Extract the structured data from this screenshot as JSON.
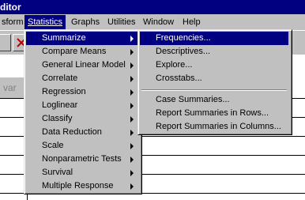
{
  "title": "ditor",
  "menubar": {
    "items": [
      {
        "label": "sform"
      },
      {
        "label": "Statistics"
      },
      {
        "label": "Graphs"
      },
      {
        "label": "Utilities"
      },
      {
        "label": "Window"
      },
      {
        "label": "Help"
      }
    ]
  },
  "grid": {
    "var_label": "var"
  },
  "statistics_menu": {
    "items": [
      {
        "label": "Summarize"
      },
      {
        "label": "Compare Means"
      },
      {
        "label": "General Linear Model"
      },
      {
        "label": "Correlate"
      },
      {
        "label": "Regression"
      },
      {
        "label": "Loglinear"
      },
      {
        "label": "Classify"
      },
      {
        "label": "Data Reduction"
      },
      {
        "label": "Scale"
      },
      {
        "label": "Nonparametric Tests"
      },
      {
        "label": "Survival"
      },
      {
        "label": "Multiple Response"
      }
    ]
  },
  "summarize_menu": {
    "items": [
      {
        "label": "Frequencies..."
      },
      {
        "label": "Descriptives..."
      },
      {
        "label": "Explore..."
      },
      {
        "label": "Crosstabs..."
      },
      {
        "label": "Case Summaries..."
      },
      {
        "label": "Report Summaries in Rows..."
      },
      {
        "label": "Report Summaries in Columns..."
      }
    ]
  },
  "colors": {
    "selection": "#000080",
    "face": "#c0c0c0"
  }
}
